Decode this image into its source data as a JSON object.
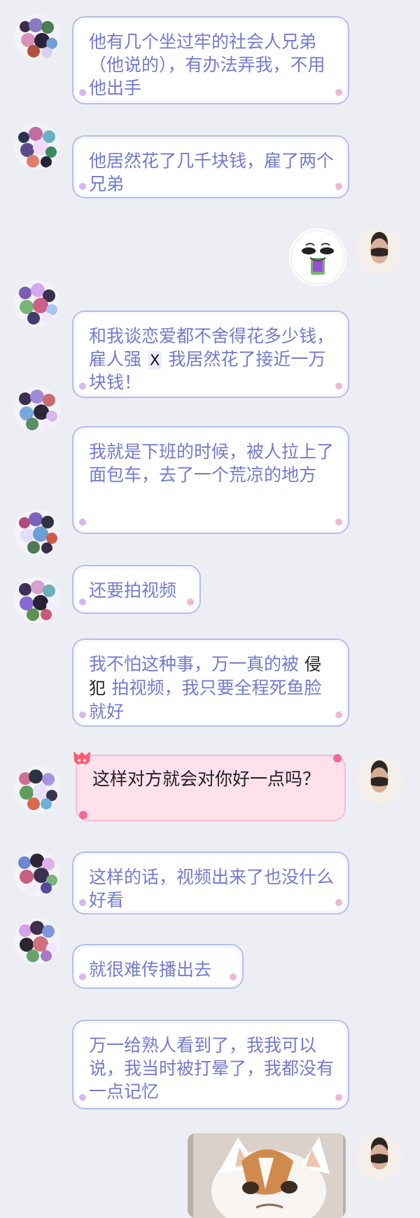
{
  "messages": [
    {
      "side": "left",
      "text": "他有几个坐过牢的社会人兄弟（他说的），有办法弄我，不用他出手"
    },
    {
      "side": "left",
      "text": "他居然花了几千块钱，雇了两个兄弟"
    },
    {
      "side": "right",
      "type": "sticker",
      "icon": "crying-face-sticker-icon"
    },
    {
      "side": "left",
      "text_parts": [
        "和我谈恋爱都不舍得花多少钱，雇人强",
        "X",
        "我居然花了接近一万块钱！"
      ]
    },
    {
      "side": "left",
      "text": "我就是下班的时候，被人拉上了面包车，去了一个荒凉的地方"
    },
    {
      "side": "left",
      "text": "还要拍视频"
    },
    {
      "side": "left",
      "text_parts": [
        "我不怕这种事，万一真的被",
        "侵犯",
        "拍视频，我只要全程死鱼脸就好"
      ]
    },
    {
      "side": "right",
      "text": "这样对方就会对你好一点吗？"
    },
    {
      "side": "left",
      "text": "这样的话，视频出来了也没什么好看"
    },
    {
      "side": "left",
      "text": "就很难传播出去"
    },
    {
      "side": "left",
      "text": "万一给熟人看到了，我我可以说，我当时被打晕了，我都没有一点记忆"
    },
    {
      "side": "right",
      "type": "image",
      "icon": "cat-photo-icon"
    }
  ],
  "colors": {
    "background": "#edeef4",
    "left_bubble_text": "#737ad0",
    "left_bubble_border": "#b7bdea",
    "right_bubble_bg": "#ffe1ec",
    "right_bubble_text": "#1f1f22"
  }
}
